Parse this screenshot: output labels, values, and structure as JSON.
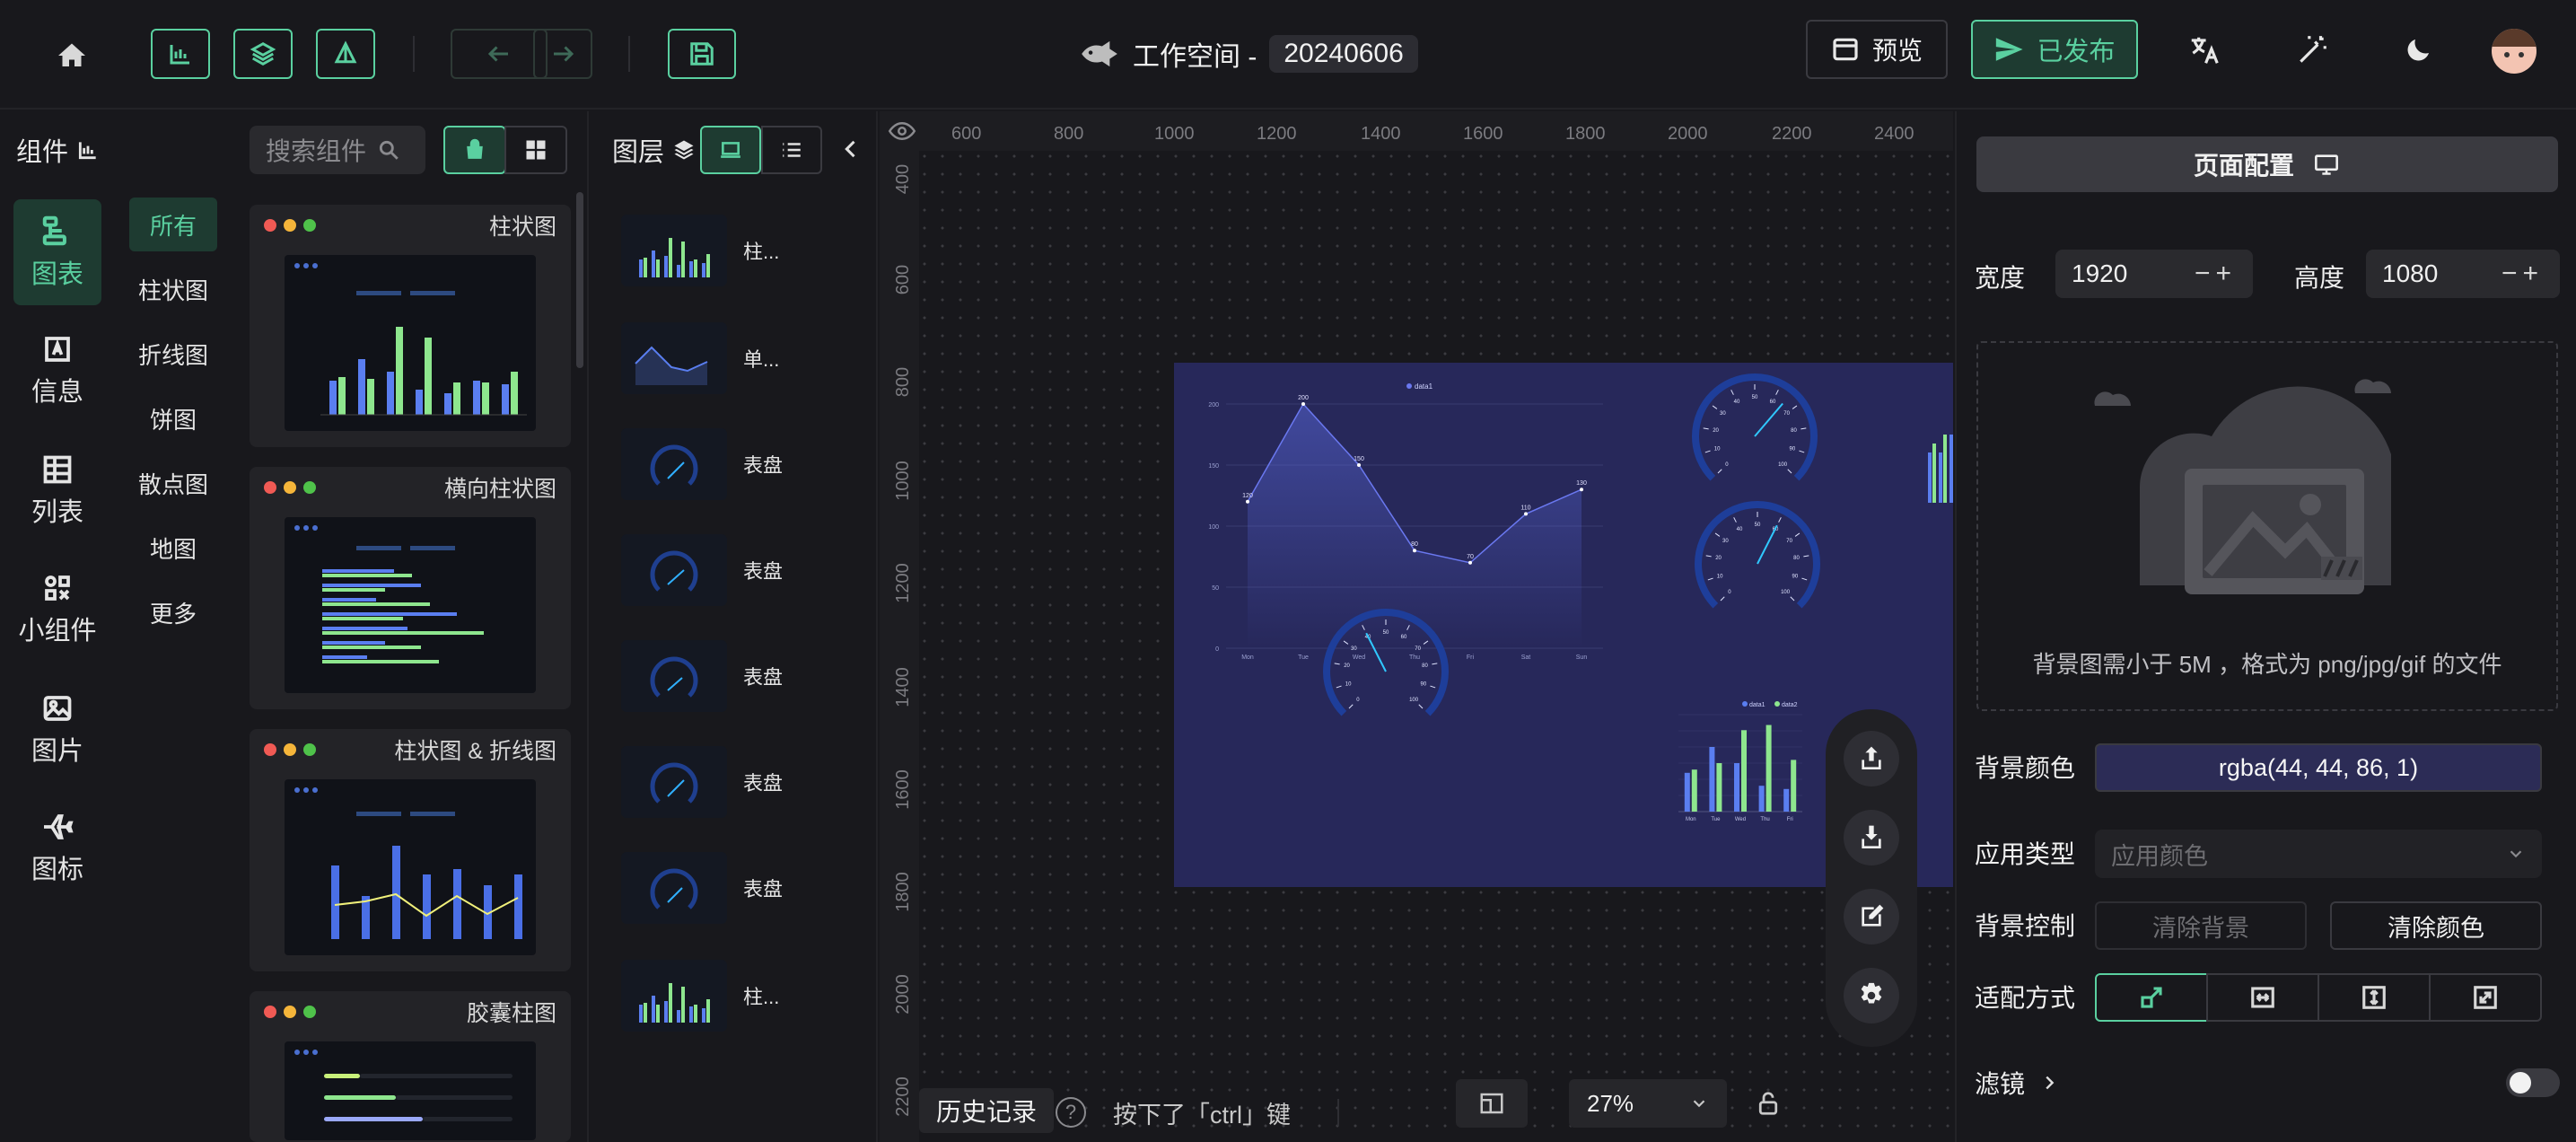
{
  "topbar": {
    "workspace_label": "工作空间 -",
    "workspace_id": "20240606",
    "preview_label": "预览",
    "publish_label": "已发布"
  },
  "rail": {
    "items": [
      {
        "label": "图表",
        "icon": "chart-icon",
        "active": true
      },
      {
        "label": "信息",
        "icon": "text-icon"
      },
      {
        "label": "列表",
        "icon": "table-icon"
      },
      {
        "label": "小组件",
        "icon": "widget-icon"
      },
      {
        "label": "图片",
        "icon": "image-icon"
      },
      {
        "label": "图标",
        "icon": "plane-icon"
      }
    ],
    "header": "组件"
  },
  "subnav": [
    "所有",
    "柱状图",
    "折线图",
    "饼图",
    "散点图",
    "地图",
    "更多"
  ],
  "components": {
    "search_placeholder": "搜索组件",
    "cards": [
      "柱状图",
      "横向柱状图",
      "柱状图 & 折线图",
      "胶囊柱图"
    ]
  },
  "layers": {
    "header": "图层",
    "items": [
      "柱...",
      "单...",
      "表盘",
      "表盘",
      "表盘",
      "表盘",
      "表盘",
      "柱..."
    ]
  },
  "canvas": {
    "ruler_h": [
      "600",
      "800",
      "1000",
      "1200",
      "1400",
      "1600",
      "1800",
      "2000",
      "2200",
      "2400"
    ],
    "ruler_v": [
      "400",
      "600",
      "800",
      "1000",
      "1200",
      "1400",
      "1600",
      "1800",
      "2000",
      "2200"
    ],
    "line_chart": {
      "legend": "data1",
      "x": [
        "Mon",
        "Tue",
        "Wed",
        "Thu",
        "Fri",
        "Sat",
        "Sun"
      ],
      "values": [
        120,
        200,
        150,
        80,
        70,
        110,
        130
      ],
      "y_ticks": [
        "0",
        "50",
        "100",
        "150",
        "200"
      ]
    },
    "bar_chart": {
      "legend": [
        "data1",
        "data2"
      ],
      "x": [
        "Mon",
        "Tue",
        "Wed",
        "Thu",
        "Fri"
      ],
      "data1": [
        120,
        200,
        150,
        80,
        70
      ],
      "data2": [
        130,
        150,
        252,
        268,
        160
      ]
    },
    "gauge_ticks": [
      "0",
      "10",
      "20",
      "30",
      "40",
      "50",
      "60",
      "70",
      "80",
      "90",
      "100"
    ]
  },
  "bottom": {
    "history_label": "历史记录",
    "hint": "按下了「ctrl」键",
    "zoom": "27%"
  },
  "panel": {
    "title": "页面配置",
    "width_label": "宽度",
    "width_value": "1920",
    "height_label": "高度",
    "height_value": "1080",
    "upload_hint": "背景图需小于 5M ，格式为 png/jpg/gif 的文件",
    "bg_color_label": "背景颜色",
    "bg_color_value": "rgba(44, 44, 86, 1)",
    "app_type_label": "应用类型",
    "app_type_value": "应用颜色",
    "bg_ctrl_label": "背景控制",
    "clear_bg": "清除背景",
    "clear_color": "清除颜色",
    "fit_label": "适配方式",
    "filter_label": "滤镜"
  },
  "colors": {
    "accent": "#5ad0a0",
    "canvas_bg": "#2c2c56"
  }
}
